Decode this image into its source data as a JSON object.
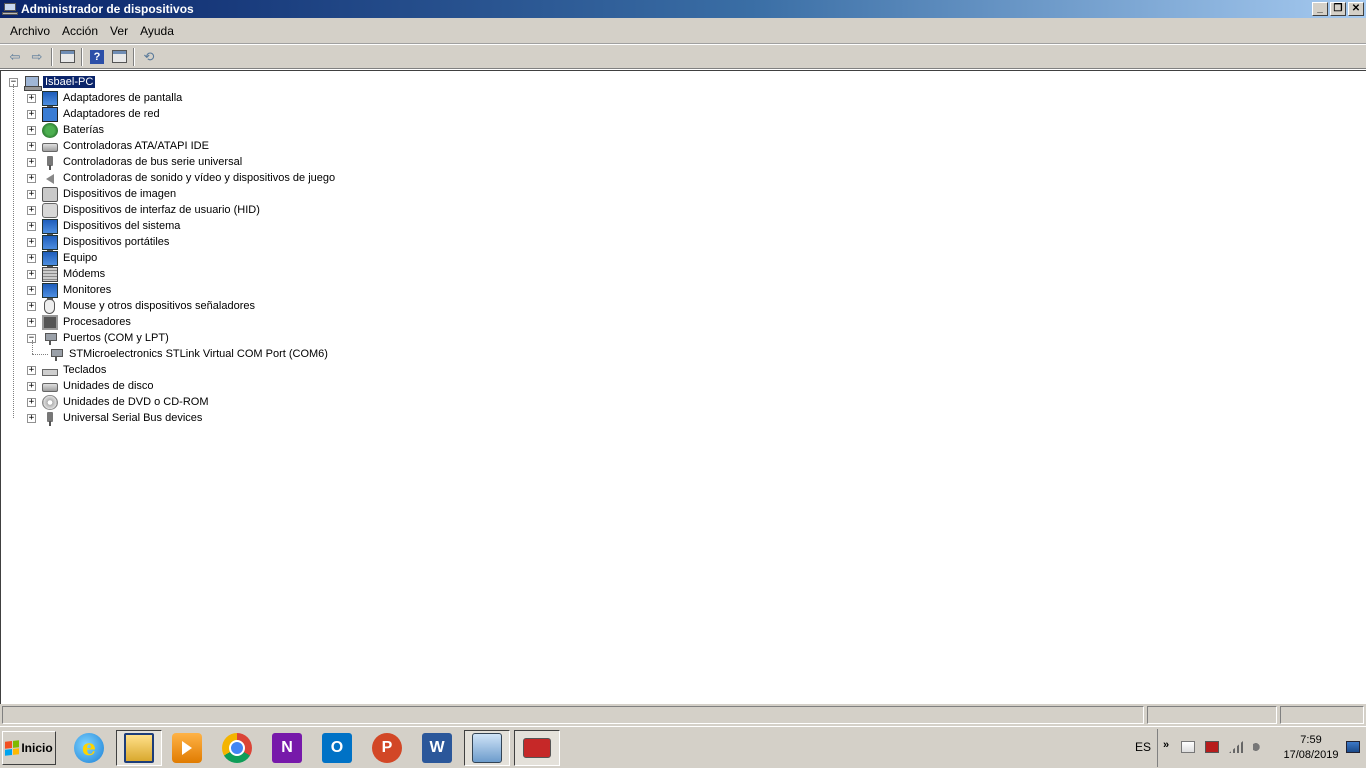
{
  "window": {
    "title": "Administrador de dispositivos",
    "buttons": {
      "minimize": "_",
      "restore": "❐",
      "close": "✕"
    }
  },
  "menu": [
    "Archivo",
    "Acción",
    "Ver",
    "Ayuda"
  ],
  "toolbar": {
    "back_icon": "back-arrow-icon",
    "forward_icon": "forward-arrow-icon",
    "console_tree_icon": "console-tree-icon",
    "help_label": "?",
    "properties_icon": "properties-icon",
    "scan_icon": "scan-hardware-icon"
  },
  "tree": {
    "root": {
      "label": "Isbael-PC",
      "expanded": true,
      "selected": true,
      "icon": "computer-icon"
    },
    "items": [
      {
        "label": "Adaptadores de pantalla",
        "icon": "display-adapter-icon",
        "expanded": false
      },
      {
        "label": "Adaptadores de red",
        "icon": "network-adapter-icon",
        "expanded": false
      },
      {
        "label": "Baterías",
        "icon": "battery-icon",
        "expanded": false
      },
      {
        "label": "Controladoras ATA/ATAPI IDE",
        "icon": "ide-controller-icon",
        "expanded": false
      },
      {
        "label": "Controladoras de bus serie universal",
        "icon": "usb-controller-icon",
        "expanded": false
      },
      {
        "label": "Controladoras de sonido y vídeo y dispositivos de juego",
        "icon": "sound-icon",
        "expanded": false
      },
      {
        "label": "Dispositivos de imagen",
        "icon": "imaging-device-icon",
        "expanded": false
      },
      {
        "label": "Dispositivos de interfaz de usuario (HID)",
        "icon": "hid-icon",
        "expanded": false
      },
      {
        "label": "Dispositivos del sistema",
        "icon": "system-device-icon",
        "expanded": false
      },
      {
        "label": "Dispositivos portátiles",
        "icon": "portable-device-icon",
        "expanded": false
      },
      {
        "label": "Equipo",
        "icon": "computer-monitor-icon",
        "expanded": false
      },
      {
        "label": "Módems",
        "icon": "modem-icon",
        "expanded": false
      },
      {
        "label": "Monitores",
        "icon": "monitor-icon",
        "expanded": false
      },
      {
        "label": "Mouse y otros dispositivos señaladores",
        "icon": "mouse-icon",
        "expanded": false
      },
      {
        "label": "Procesadores",
        "icon": "processor-icon",
        "expanded": false
      },
      {
        "label": "Puertos (COM y LPT)",
        "icon": "port-icon",
        "expanded": true,
        "children": [
          {
            "label": "STMicroelectronics STLink Virtual COM Port (COM6)",
            "icon": "port-icon"
          }
        ]
      },
      {
        "label": "Teclados",
        "icon": "keyboard-icon",
        "expanded": false
      },
      {
        "label": "Unidades de disco",
        "icon": "disk-drive-icon",
        "expanded": false
      },
      {
        "label": "Unidades de DVD o CD-ROM",
        "icon": "dvd-icon",
        "expanded": false
      },
      {
        "label": "Universal Serial Bus devices",
        "icon": "usb-device-icon",
        "expanded": false
      }
    ],
    "expand_symbol": "+",
    "collapse_symbol": "−"
  },
  "taskbar": {
    "start_label": "Inicio",
    "apps": [
      {
        "name": "internet-explorer-icon",
        "glyph": "e"
      },
      {
        "name": "file-explorer-icon",
        "glyph": ""
      },
      {
        "name": "media-player-icon",
        "glyph": ""
      },
      {
        "name": "chrome-icon",
        "glyph": ""
      },
      {
        "name": "onenote-icon",
        "glyph": "N"
      },
      {
        "name": "outlook-icon",
        "glyph": "O"
      },
      {
        "name": "powerpoint-icon",
        "glyph": "P"
      },
      {
        "name": "word-icon",
        "glyph": "W"
      },
      {
        "name": "control-panel-icon",
        "glyph": ""
      },
      {
        "name": "device-manager-toolbox-icon",
        "glyph": ""
      }
    ],
    "language": "ES",
    "tray_arrow": "»",
    "time": "7:59",
    "date": "17/08/2019"
  },
  "colors": {
    "selection": "#0a246a",
    "chrome": "#d4d0c8",
    "title_gradient_start": "#0a246a",
    "title_gradient_end": "#a6caf0"
  }
}
